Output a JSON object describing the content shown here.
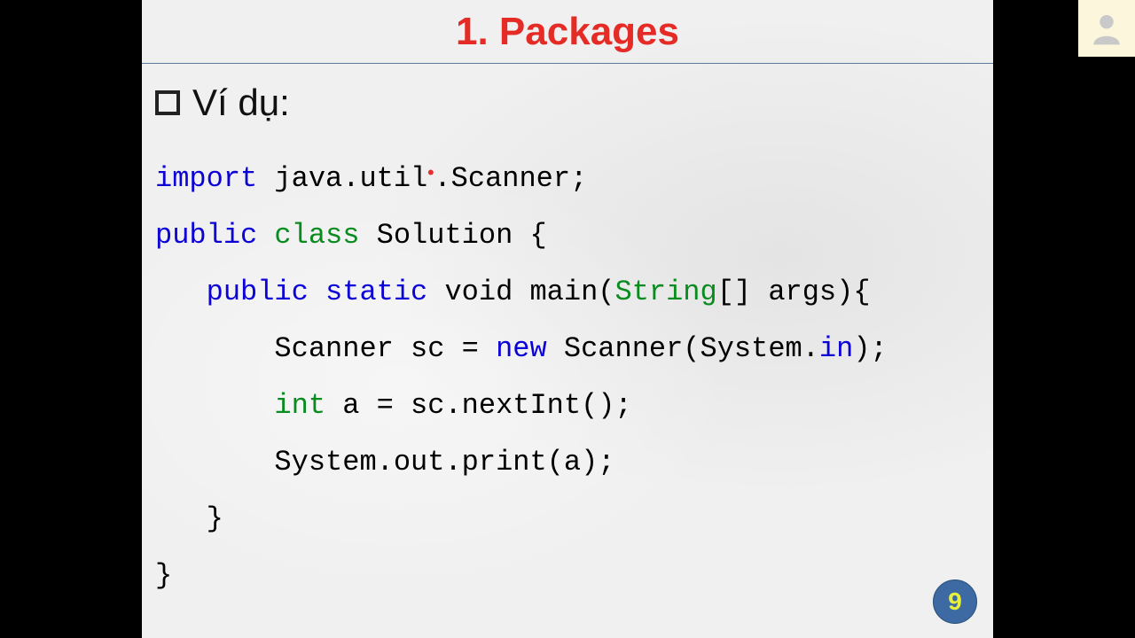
{
  "title": "1. Packages",
  "example_label": "Ví dụ:",
  "code": {
    "l1_import": "import",
    "l1_rest1": " java.util",
    "l1_dot": ".",
    "l1_rest2": "Scanner;",
    "l2_public": "public",
    "l2_class": "class",
    "l2_rest": " Solution {",
    "l3_indent": "   ",
    "l3_public": "public",
    "l3_static": "static",
    "l3_void": " void main(",
    "l3_string": "String",
    "l3_rest": "[] args){",
    "l4_indent": "       ",
    "l4_a": "Scanner sc = ",
    "l4_new": "new",
    "l4_b": " Scanner(System.",
    "l4_in": "in",
    "l4_c": ");",
    "l5_indent": "       ",
    "l5_int": "int",
    "l5_rest": " a = sc.nextInt();",
    "l6": "       System.out.print(a);",
    "l7": "   }",
    "l8": "}"
  },
  "page_number": "9"
}
